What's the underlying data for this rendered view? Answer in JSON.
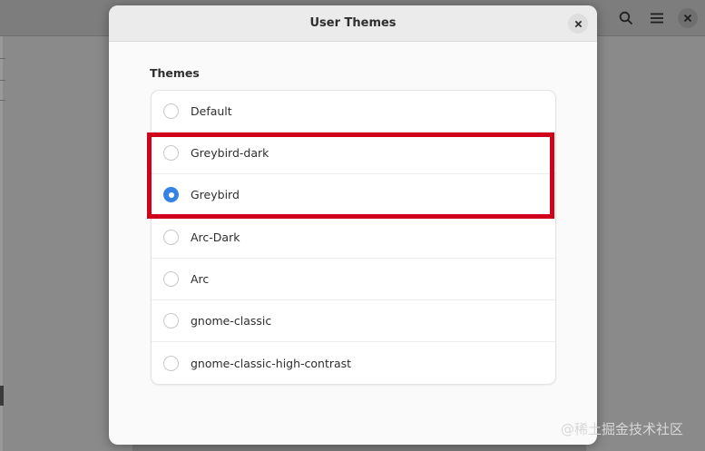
{
  "dialog": {
    "title": "User Themes",
    "section_label": "Themes",
    "themes": [
      {
        "label": "Default",
        "selected": false
      },
      {
        "label": "Greybird-dark",
        "selected": false
      },
      {
        "label": "Greybird",
        "selected": true
      },
      {
        "label": "Arc-Dark",
        "selected": false
      },
      {
        "label": "Arc",
        "selected": false
      },
      {
        "label": "gnome-classic",
        "selected": false
      },
      {
        "label": "gnome-classic-high-contrast",
        "selected": false
      }
    ]
  },
  "background": {
    "icons": [
      "search-icon",
      "menu-icon",
      "close-icon"
    ]
  },
  "watermark": "@稀土掘金技术社区",
  "colors": {
    "accent": "#3584e4",
    "highlight": "#d0021b"
  }
}
